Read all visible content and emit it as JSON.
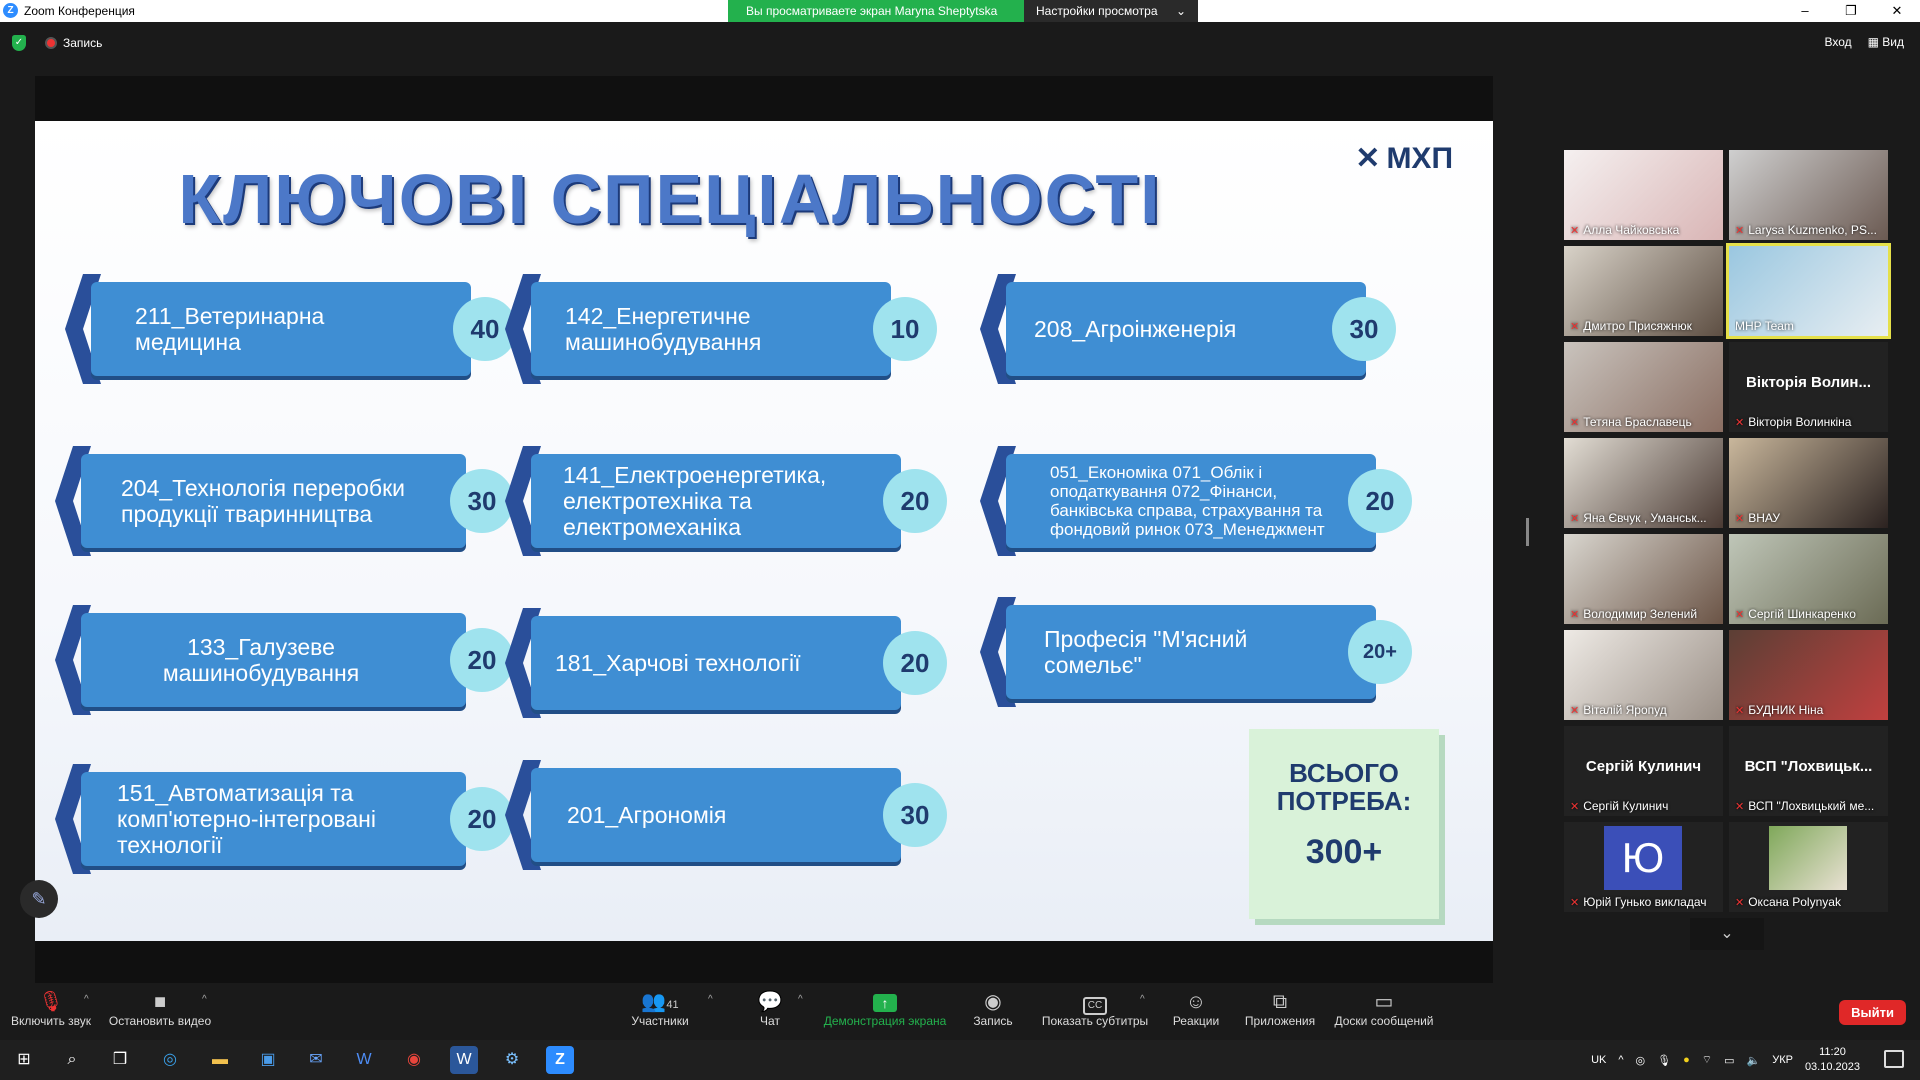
{
  "window": {
    "title": "Zoom Конференция",
    "share_banner": "Вы просматриваете экран Maryna Sheptytska",
    "view_options": "Настройки просмотра",
    "controls": {
      "minimize": "–",
      "maximize": "❐",
      "close": "✕"
    }
  },
  "topbar": {
    "record_label": "Запись",
    "login": "Вход",
    "view": "Вид"
  },
  "slide": {
    "title": "КЛЮЧОВІ СПЕЦІАЛЬНОСТІ",
    "logo": "МХП",
    "specialties": [
      {
        "label": "211_Ветеринарна медицина",
        "count": "40"
      },
      {
        "label": "142_Енергетичне машинобудування",
        "count": "10"
      },
      {
        "label": "208_Агроінженерія",
        "count": "30"
      },
      {
        "label": "204_Технологія переробки продукції тваринництва",
        "count": "30"
      },
      {
        "label": "141_Електроенергетика, електротехніка та електромеханіка",
        "count": "20"
      },
      {
        "label": "051_Економіка 071_Облік і оподаткування 072_Фінанси, банківська справа, страхування та фондовий ринок 073_Менеджмент",
        "count": "20"
      },
      {
        "label": "133_Галузеве машинобудування",
        "count": "20"
      },
      {
        "label": "181_Харчові технології",
        "count": "20"
      },
      {
        "label": "Професія \"М'ясний сомельє\"",
        "count": "20+"
      },
      {
        "label": "151_Автоматизація та комп'ютерно-інтегровані технології",
        "count": "20"
      },
      {
        "label": "201_Агрономія",
        "count": "30"
      }
    ],
    "total_label": "ВСЬОГО ПОТРЕБА:",
    "total_value": "300+"
  },
  "participants": [
    {
      "name": "Алла Чайковська"
    },
    {
      "name": "Larysa Kuzmenko, PS..."
    },
    {
      "name": "Дмитро Присяжнюк"
    },
    {
      "name": "MHP Team"
    },
    {
      "name": "Тетяна Браславець"
    },
    {
      "name": "Вікторія Волинкіна",
      "display": "Вікторія Волин..."
    },
    {
      "name": "Яна Євчук , Уманськ..."
    },
    {
      "name": "ВНАУ"
    },
    {
      "name": "Володимир Зелений"
    },
    {
      "name": "Сергій Шинкаренко"
    },
    {
      "name": "Віталій Яропуд"
    },
    {
      "name": "БУДНИК Ніна"
    },
    {
      "name": "Сергій Кулинич",
      "display": "Сергій Кулинич"
    },
    {
      "name": "ВСП \"Лохвицький ме...",
      "display": "ВСП \"Лохвицьк..."
    },
    {
      "name": "Юрій Гунько викладач",
      "avatar": "Ю"
    },
    {
      "name": "Oксана Polynyak"
    }
  ],
  "toolbar": {
    "unmute": "Включить звук",
    "stop_video": "Остановить видео",
    "participants": "Участники",
    "participants_count": "41",
    "chat": "Чат",
    "share_screen": "Демонстрация экрана",
    "record": "Запись",
    "captions": "Показать субтитры",
    "reactions": "Реакции",
    "apps": "Приложения",
    "whiteboards": "Доски сообщений",
    "leave": "Выйти"
  },
  "taskbar": {
    "lang": "UK",
    "kb": "УКР",
    "time": "11:20",
    "date": "03.10.2023"
  }
}
